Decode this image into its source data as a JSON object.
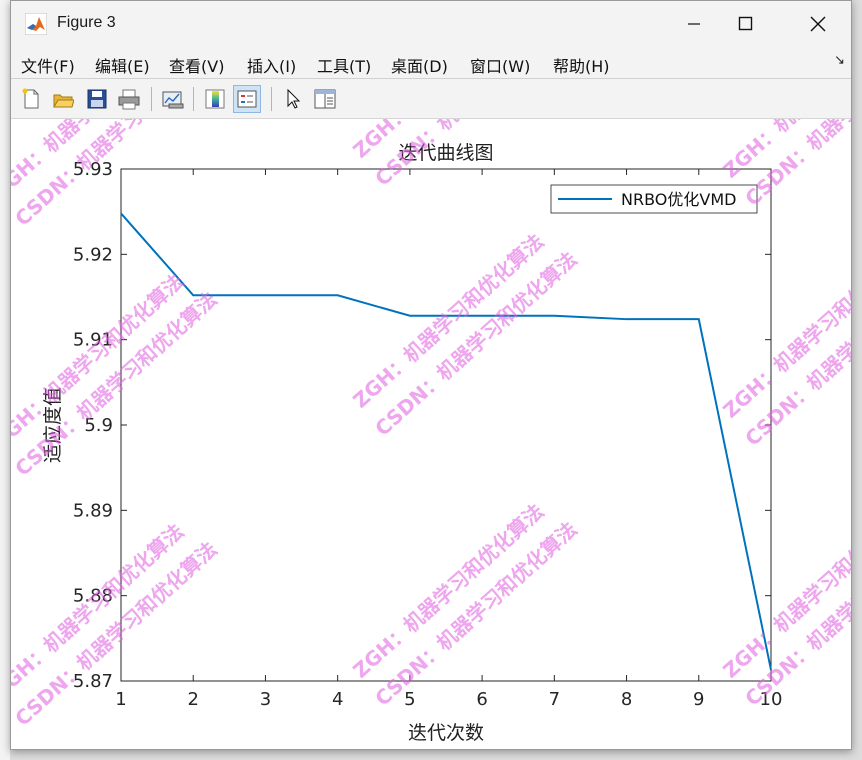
{
  "window": {
    "title": "Figure 3",
    "minimize_glyph": "—",
    "maximize_glyph": "☐",
    "close_glyph": "✕"
  },
  "menu": {
    "items": [
      "文件(F)",
      "编辑(E)",
      "查看(V)",
      "插入(I)",
      "工具(T)",
      "桌面(D)",
      "窗口(W)",
      "帮助(H)"
    ],
    "dock_glyph": "↘"
  },
  "toolbar": {
    "buttons": [
      "new-figure-icon",
      "open-file-icon",
      "save-icon",
      "print-icon",
      "link-plot-icon",
      "insert-colorbar-icon",
      "insert-legend-icon",
      "edit-plot-cursor-icon",
      "property-inspector-icon"
    ]
  },
  "chart_data": {
    "type": "line",
    "title": "迭代曲线图",
    "xlabel": "迭代次数",
    "ylabel": "适应度值",
    "xlim": [
      1,
      10
    ],
    "ylim": [
      5.87,
      5.93
    ],
    "xticks": [
      "1",
      "2",
      "3",
      "4",
      "5",
      "6",
      "7",
      "8",
      "9",
      "10"
    ],
    "yticks": [
      "5.87",
      "5.88",
      "5.89",
      "5.9",
      "5.91",
      "5.92",
      "5.93"
    ],
    "grid": false,
    "legend_position": "top-right",
    "series": [
      {
        "name": "NRBO优化VMD",
        "color": "#0072BD",
        "x": [
          1,
          2,
          3,
          4,
          5,
          6,
          7,
          8,
          9,
          10
        ],
        "y": [
          5.9248,
          5.9152,
          5.9152,
          5.9152,
          5.9128,
          5.9128,
          5.9128,
          5.9124,
          5.9124,
          5.8713
        ]
      }
    ]
  },
  "watermark": {
    "lines": [
      "ZGH：机器学习和优化算法",
      "CSDN：机器学习和优化算法"
    ],
    "color": "#e05ce0"
  }
}
